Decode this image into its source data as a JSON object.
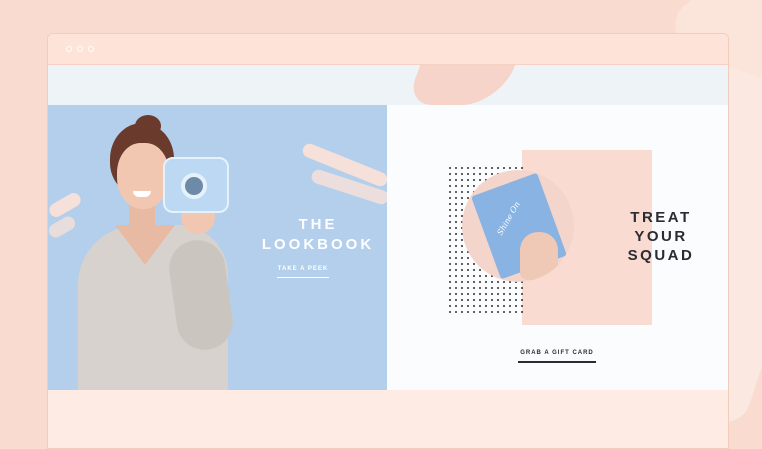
{
  "window": {
    "controls": [
      "window-dot",
      "window-dot",
      "window-dot"
    ]
  },
  "lookbook": {
    "title_line1": "THE",
    "title_line2": "LOOKBOOK",
    "cta": "TAKE A PEEK"
  },
  "giftcard": {
    "title_line1": "TREAT",
    "title_line2": "YOUR",
    "title_line3": "SQUAD",
    "cta": "GRAB A GIFT CARD"
  },
  "colors": {
    "page_background": "#f9dccf",
    "lookbook_panel": "#b4cfec",
    "gift_panel": "#f9dbd2",
    "dark_text": "#2c2b30"
  },
  "icons": [
    "window-dot-icon",
    "dot-grid-pattern"
  ]
}
